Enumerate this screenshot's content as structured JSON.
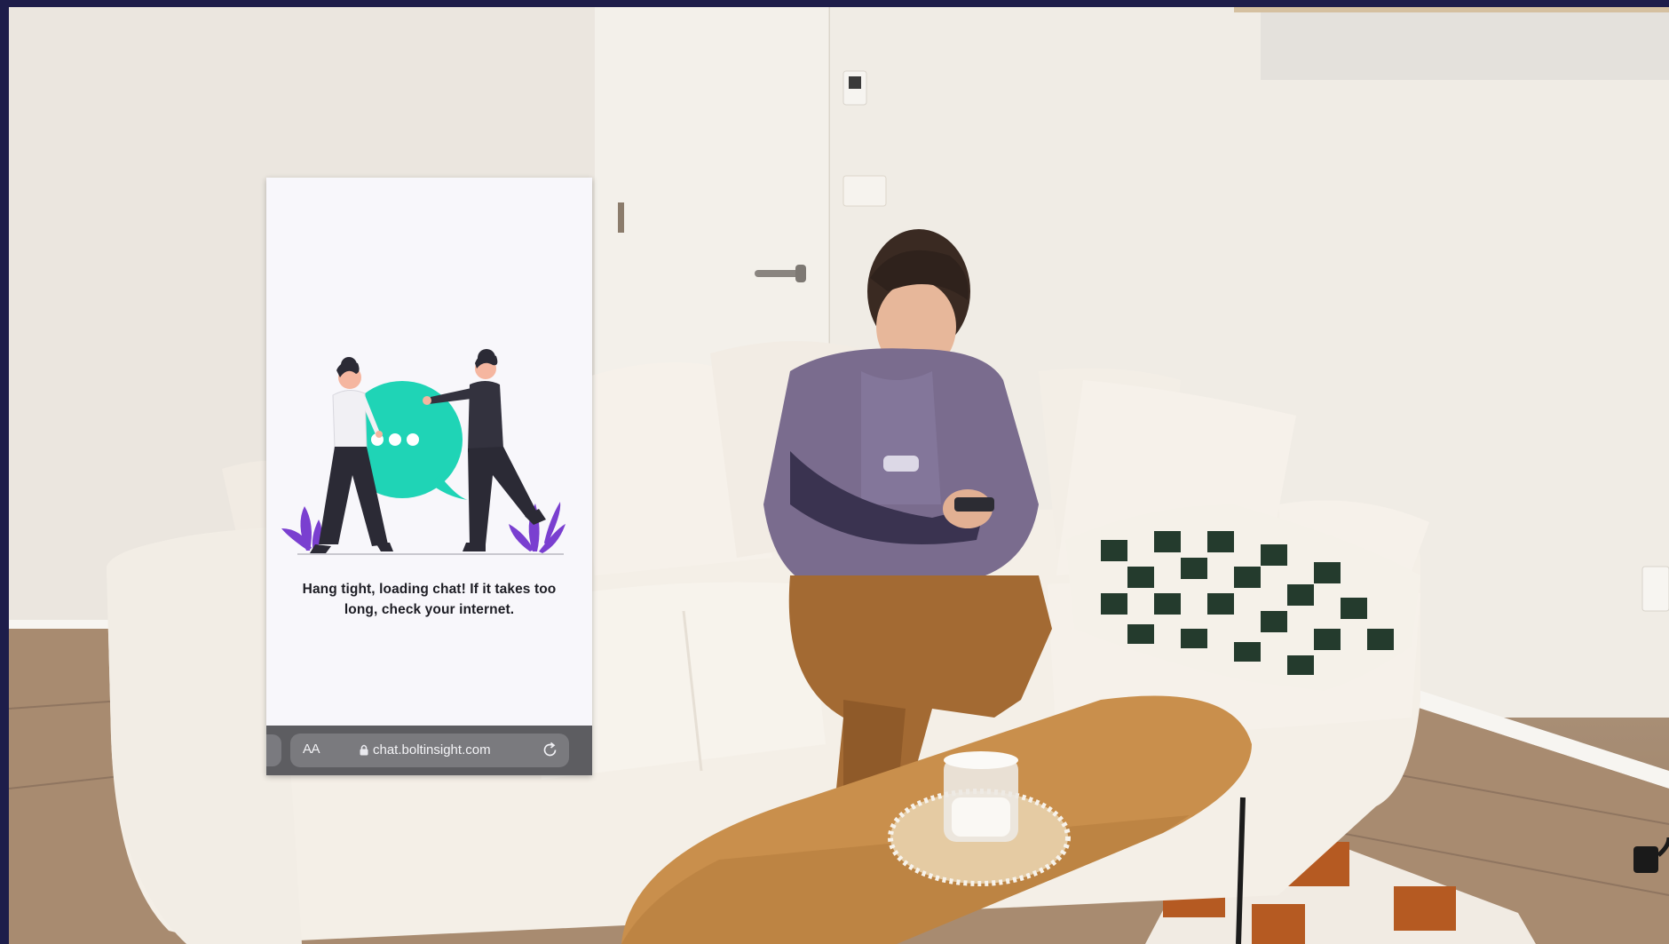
{
  "overlay": {
    "message": "Hang tight, loading chat! If it takes too long, check your internet.",
    "browser": {
      "text_size_label": "AA",
      "url": "chat.boltinsight.com"
    }
  },
  "colors": {
    "border": "#1e1d4a",
    "wall": "#eeeae4",
    "sofa": "#f4efe7",
    "sweatshirt": "#7a6c8e",
    "trousers": "#a36a33",
    "table": "#c98f4c",
    "bubble": "#1fd4b6",
    "leaves": "#7a3fd0"
  },
  "icons": {
    "lock": "lock-icon",
    "reload": "reload-icon",
    "chat": "chat-bubble-icon"
  }
}
